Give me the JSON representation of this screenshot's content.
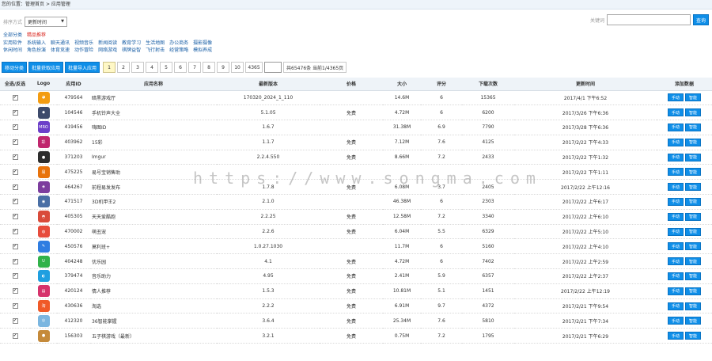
{
  "breadcrumb": {
    "prefix": "您的位置：",
    "home": "管理首页",
    "sep": " > ",
    "current": "应用管理"
  },
  "filter": {
    "label": "排序方式",
    "selected": "更新时间"
  },
  "search": {
    "label": "关键词",
    "placeholder": "",
    "button": "查询"
  },
  "categories": [
    [
      {
        "label": "全部分类",
        "active": false
      },
      {
        "label": "精品推荐",
        "active": true
      }
    ],
    [
      {
        "label": "实用软件",
        "active": false
      },
      {
        "label": "系统输入",
        "active": false
      },
      {
        "label": "聊天通讯",
        "active": false
      },
      {
        "label": "视频音乐",
        "active": false
      },
      {
        "label": "新闻阅读",
        "active": false
      },
      {
        "label": "教育学习",
        "active": false
      },
      {
        "label": "生活地图",
        "active": false
      },
      {
        "label": "办公商务",
        "active": false
      },
      {
        "label": "摄影摄像",
        "active": false
      }
    ],
    [
      {
        "label": "休闲时间",
        "active": false
      },
      {
        "label": "角色扮演",
        "active": false
      },
      {
        "label": "体育竞速",
        "active": false
      },
      {
        "label": "动作冒险",
        "active": false
      },
      {
        "label": "网络游戏",
        "active": false
      },
      {
        "label": "棋牌益智",
        "active": false
      },
      {
        "label": "飞行射击",
        "active": false
      },
      {
        "label": "经营策略",
        "active": false
      },
      {
        "label": "模拟养成",
        "active": false
      }
    ]
  ],
  "toolbar": {
    "btn1": "移动分类",
    "btn2": "批量获取应用",
    "btn3": "批量导入应用"
  },
  "pager": {
    "pages": [
      "1",
      "2",
      "3",
      "4",
      "5",
      "6",
      "7",
      "8",
      "9",
      "10",
      "4365"
    ],
    "current": "1",
    "info": "共65476条 当前1/4365页"
  },
  "table": {
    "headers": {
      "select": "全选/反选",
      "logo": "Logo",
      "id": "应用ID",
      "name": "应用名称",
      "version": "最新版本",
      "price": "价格",
      "size": "大小",
      "score": "评分",
      "downloads": "下载次数",
      "updated": "更新时间",
      "actions": "添加数据"
    },
    "rows": [
      {
        "check": "✔",
        "logo_color": "#f39c12",
        "logo_glyph": "◕",
        "id": "479564",
        "name": "暗黑游戏厅",
        "version": "170320_2024_1_110",
        "price": "",
        "size": "14.6M",
        "score": "6",
        "downloads": "15365",
        "updated": "2017/4/1 下午6:52"
      },
      {
        "check": "✔",
        "logo_color": "#3d4a6b",
        "logo_glyph": "◆",
        "id": "104546",
        "name": "手机铃声大全",
        "version": "5.1.05",
        "price": "免费",
        "size": "4.72M",
        "score": "6",
        "downloads": "6200",
        "updated": "2017/3/26 下午6:36"
      },
      {
        "check": "✔",
        "logo_color": "#6c3fc9",
        "logo_glyph": "MRO",
        "id": "419456",
        "name": "嗨图ID",
        "version": "1.6.7",
        "price": "",
        "size": "31.38M",
        "score": "6.9",
        "downloads": "7790",
        "updated": "2017/3/28 下午6:36"
      },
      {
        "check": "✔",
        "logo_color": "#c0266d",
        "logo_glyph": "彩",
        "id": "403962",
        "name": "15彩",
        "version": "1.1.7",
        "price": "免费",
        "size": "7.12M",
        "score": "7.6",
        "downloads": "4125",
        "updated": "2017/2/22 下午4:33"
      },
      {
        "check": "✔",
        "logo_color": "#2d2d2d",
        "logo_glyph": "●",
        "id": "371203",
        "name": "Imgur",
        "version": "2.2.4.550",
        "price": "免费",
        "size": "8.66M",
        "score": "7.2",
        "downloads": "2433",
        "updated": "2017/2/22 下午1:32"
      },
      {
        "check": "✔",
        "logo_color": "#e8730c",
        "logo_glyph": "易",
        "id": "475225",
        "name": "易号宝销售助",
        "version": "",
        "price": "",
        "size": "",
        "score": "",
        "downloads": "",
        "updated": "2017/2/22 下午1:11"
      },
      {
        "check": "✔",
        "logo_color": "#7d3e9e",
        "logo_glyph": "◈",
        "id": "464267",
        "name": "前程易发发布",
        "version": "1.7.8",
        "price": "免费",
        "size": "6.08M",
        "score": "3.7",
        "downloads": "2405",
        "updated": "2017/2/22 上午12:16"
      },
      {
        "check": "✔",
        "logo_color": "#4a6fa5",
        "logo_glyph": "◉",
        "id": "471517",
        "name": "3D机甲王2",
        "version": "2.1.0",
        "price": "",
        "size": "46.38M",
        "score": "6",
        "downloads": "2303",
        "updated": "2017/2/22 上午6:17"
      },
      {
        "check": "✔",
        "logo_color": "#d94b3a",
        "logo_glyph": "◓",
        "id": "405305",
        "name": "天天爱酷跑",
        "version": "2.2.25",
        "price": "免费",
        "size": "12.58M",
        "score": "7.2",
        "downloads": "3340",
        "updated": "2017/2/22 上午6:10"
      },
      {
        "check": "✔",
        "logo_color": "#e74c3c",
        "logo_glyph": "◍",
        "id": "470002",
        "name": "萌丑宠",
        "version": "2.2.6",
        "price": "免费",
        "size": "6.04M",
        "score": "5.5",
        "downloads": "6329",
        "updated": "2017/2/22 上午5:10"
      },
      {
        "check": "✔",
        "logo_color": "#2f7de1",
        "logo_glyph": "✎",
        "id": "450576",
        "name": "莫利班+",
        "version": "1.0.27.1030",
        "price": "",
        "size": "11.7M",
        "score": "6",
        "downloads": "5160",
        "updated": "2017/2/22 上午4:10"
      },
      {
        "check": "✔",
        "logo_color": "#31b24a",
        "logo_glyph": "U",
        "id": "404248",
        "name": "优乐园",
        "version": "4.1",
        "price": "免费",
        "size": "4.72M",
        "score": "6",
        "downloads": "7402",
        "updated": "2017/2/22 上午2:59"
      },
      {
        "check": "✔",
        "logo_color": "#1f9fe0",
        "logo_glyph": "◐",
        "id": "379474",
        "name": "音乐助力",
        "version": "4.95",
        "price": "免费",
        "size": "2.41M",
        "score": "5.9",
        "downloads": "6357",
        "updated": "2017/2/22 上午2:37"
      },
      {
        "check": "✔",
        "logo_color": "#d6336c",
        "logo_glyph": "▤",
        "id": "420124",
        "name": "情人推荐",
        "version": "1.5.3",
        "price": "免费",
        "size": "10.81M",
        "score": "5.1",
        "downloads": "1451",
        "updated": "2017/2/22 上午12:19"
      },
      {
        "check": "✔",
        "logo_color": "#f05a28",
        "logo_glyph": "淘",
        "id": "430636",
        "name": "淘选",
        "version": "2.2.2",
        "price": "免费",
        "size": "6.91M",
        "score": "9.7",
        "downloads": "4372",
        "updated": "2017/2/21 下午9:54"
      },
      {
        "check": "✔",
        "logo_color": "#7bb6e0",
        "logo_glyph": "◎",
        "id": "412320",
        "name": "36智能掌握",
        "version": "3.6.4",
        "price": "免费",
        "size": "25.34M",
        "score": "7.6",
        "downloads": "5810",
        "updated": "2017/2/21 下午7:34"
      },
      {
        "check": "✔",
        "logo_color": "#c58a3a",
        "logo_glyph": "●",
        "id": "156303",
        "name": "五子棋游戏（最新）",
        "version": "3.2.1",
        "price": "免费",
        "size": "0.75M",
        "score": "7.2",
        "downloads": "1795",
        "updated": "2017/2/21 下午6:29"
      }
    ],
    "action1": "手动",
    "action2": "智能"
  },
  "watermark": "https://www.songma.com"
}
